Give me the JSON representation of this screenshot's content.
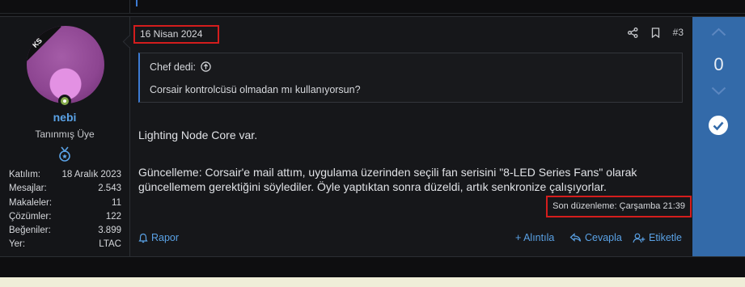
{
  "user": {
    "avatar_badge": "KS",
    "name": "nebi",
    "title": "Tanınmış Üye",
    "stats": [
      {
        "label": "Katılım:",
        "value": "18 Aralık 2023"
      },
      {
        "label": "Mesajlar:",
        "value": "2.543"
      },
      {
        "label": "Makaleler:",
        "value": "11"
      },
      {
        "label": "Çözümler:",
        "value": "122"
      },
      {
        "label": "Beğeniler:",
        "value": "3.899"
      },
      {
        "label": "Yer:",
        "value": "LTAC"
      }
    ]
  },
  "post": {
    "date": "16 Nisan 2024",
    "number": "#3",
    "quote_author": "Chef dedi:",
    "quote_text": "Corsair kontrolcüsü olmadan mı kullanıyorsun?",
    "line1": "Lighting Node Core var.",
    "line2": "Güncelleme: Corsair'e mail attım, uygulama üzerinden seçili fan serisini \"8-LED Series Fans\" olarak",
    "line3": "güncellemem gerektiğini söylediler. Öyle yaptıktan sonra düzeldi, artık senkronize çalışıyorlar.",
    "edited": "Son düzenleme: Çarşamba 21:39",
    "report": "Rapor",
    "quote_btn": "+ Alıntıla",
    "reply": "Cevapla",
    "tag": "Etiketle"
  },
  "vote": {
    "score": "0"
  },
  "colors": {
    "accent": "#336aa9",
    "link": "#5aa2e6",
    "highlight_border": "#d41d1d"
  },
  "icons": [
    "share-icon",
    "bookmark-icon",
    "arrow-up-circle-icon",
    "upvote-icon",
    "downvote-icon",
    "solution-check-icon",
    "flag-icon",
    "reply-icon",
    "tag-user-icon",
    "medal-icon"
  ]
}
